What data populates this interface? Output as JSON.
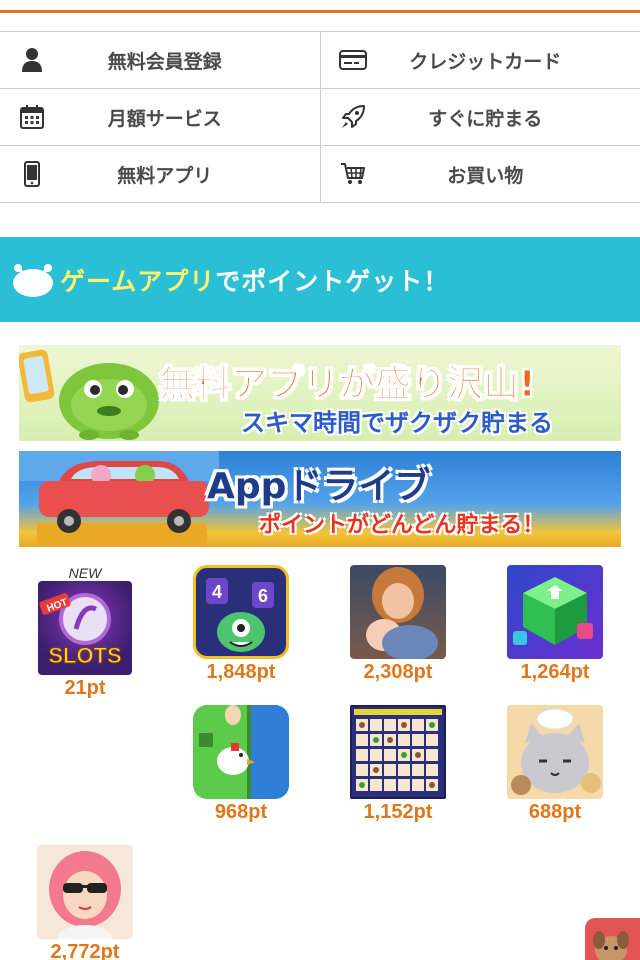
{
  "nav": {
    "rows": [
      [
        {
          "label": "無料会員登録",
          "icon": "user-icon"
        },
        {
          "label": "クレジットカード",
          "icon": "credit-card-icon"
        }
      ],
      [
        {
          "label": "月額サービス",
          "icon": "calendar-icon"
        },
        {
          "label": "すぐに貯まる",
          "icon": "rocket-icon"
        }
      ],
      [
        {
          "label": "無料アプリ",
          "icon": "smartphone-icon"
        },
        {
          "label": "お買い物",
          "icon": "shopping-cart-icon"
        }
      ]
    ]
  },
  "section": {
    "title_highlight": "ゲームアプリ",
    "title_rest": "でポイントゲット！"
  },
  "ads": [
    {
      "main": "無料アプリが盛り沢山!",
      "sub": "スキマ時間でザクザク貯まる"
    },
    {
      "main": "Appドライブ",
      "sub": "ポイントがどんどん貯まる！"
    }
  ],
  "apps": [
    {
      "tag": "NEW",
      "points": "21pt",
      "icon": "slots-app-icon"
    },
    {
      "points": "1,848pt",
      "icon": "number-monster-app-icon"
    },
    {
      "points": "2,308pt",
      "icon": "family-drama-app-icon"
    },
    {
      "points": "1,264pt",
      "icon": "cube-puzzle-app-icon"
    },
    {
      "points": "968pt",
      "icon": "chicken-egg-app-icon"
    },
    {
      "points": "1,152pt",
      "icon": "tile-match-app-icon"
    },
    {
      "points": "688pt",
      "icon": "cat-chef-app-icon"
    },
    {
      "points": "2,772pt",
      "icon": "sunglasses-girl-app-icon"
    }
  ],
  "colors": {
    "accent": "#e0731f",
    "section_bg": "#2bbfd6",
    "points": "#e0771b"
  }
}
